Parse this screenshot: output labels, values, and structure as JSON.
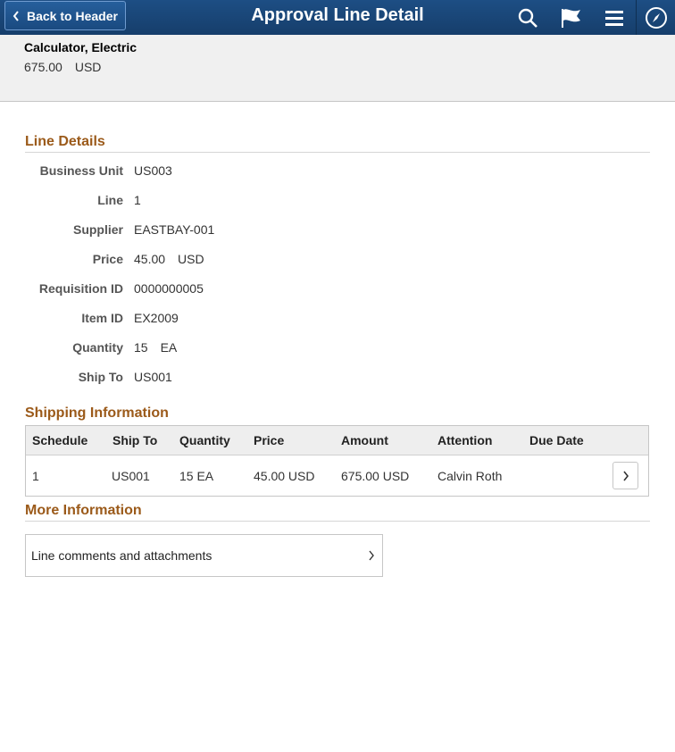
{
  "header": {
    "back_label": "Back to Header",
    "title": "Approval Line Detail",
    "icons": [
      "chevron-left-icon",
      "search-icon",
      "flag-icon",
      "menu-icon",
      "navbar-compass-icon"
    ],
    "bg_color": "#1d4e84"
  },
  "summary": {
    "item": "Calculator, Electric",
    "amount": "675.00",
    "currency": "USD"
  },
  "line_details": {
    "heading": "Line Details",
    "fields": [
      {
        "label": "Business Unit",
        "value": "US003",
        "unit": ""
      },
      {
        "label": "Line",
        "value": "1",
        "unit": ""
      },
      {
        "label": "Supplier",
        "value": "EASTBAY-001",
        "unit": ""
      },
      {
        "label": "Price",
        "value": "45.00",
        "unit": "USD"
      },
      {
        "label": "Requisition ID",
        "value": "0000000005",
        "unit": ""
      },
      {
        "label": "Item ID",
        "value": "EX2009",
        "unit": ""
      },
      {
        "label": "Quantity",
        "value": "15",
        "unit": "EA"
      },
      {
        "label": "Ship To",
        "value": "US001",
        "unit": ""
      }
    ]
  },
  "shipping": {
    "heading": "Shipping Information",
    "columns": [
      "Schedule",
      "Ship To",
      "Quantity",
      "Price",
      "Amount",
      "Attention",
      "Due Date"
    ],
    "rows": [
      [
        "1",
        "US001",
        "15 EA",
        "45.00 USD",
        "675.00 USD",
        "Calvin Roth",
        ""
      ]
    ]
  },
  "more_info": {
    "heading": "More Information",
    "link_label": "Line comments and attachments"
  },
  "colors": {
    "section_heading": "#9b5a1a"
  }
}
